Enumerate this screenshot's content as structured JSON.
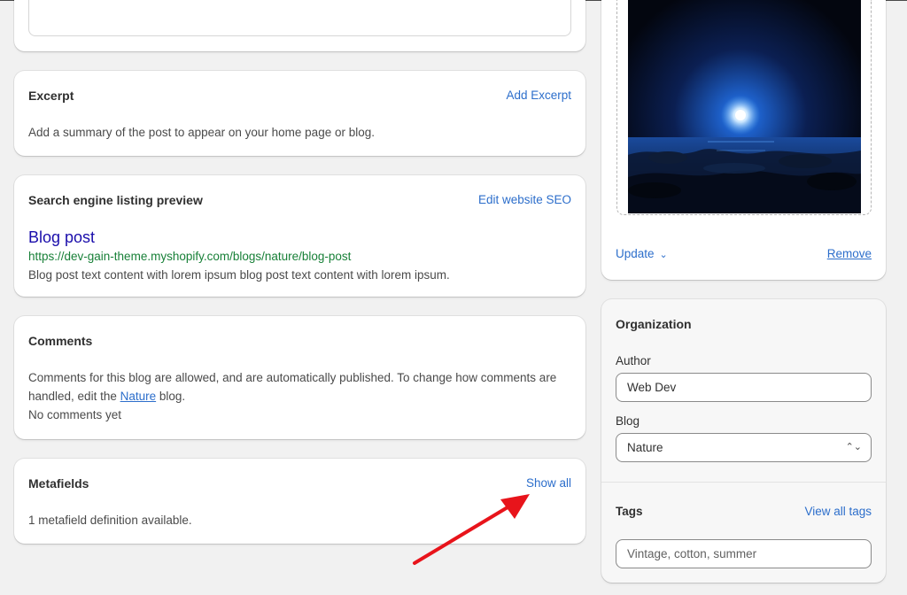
{
  "excerpt": {
    "title": "Excerpt",
    "action": "Add Excerpt",
    "description": "Add a summary of the post to appear on your home page or blog."
  },
  "seo": {
    "title": "Search engine listing preview",
    "action": "Edit website SEO",
    "preview_title": "Blog post",
    "preview_url": "https://dev-gain-theme.myshopify.com/blogs/nature/blog-post",
    "preview_description": "Blog post text content with lorem ipsum blog post text content with lorem ipsum."
  },
  "comments": {
    "title": "Comments",
    "line1": "Comments for this blog are allowed, and are automatically published. To change how comments are",
    "line2_before": "handled, edit the ",
    "line2_link": "Nature",
    "line2_after": " blog.",
    "status": "No comments yet"
  },
  "metafields": {
    "title": "Metafields",
    "action": "Show all",
    "description": "1 metafield definition available."
  },
  "image": {
    "icon": "night-ocean-image",
    "update_label": "Update",
    "remove_label": "Remove"
  },
  "organization": {
    "title": "Organization",
    "author_label": "Author",
    "author_value": "Web Dev",
    "blog_label": "Blog",
    "blog_value": "Nature",
    "tags_label": "Tags",
    "tags_action": "View all tags",
    "tags_placeholder": "Vintage, cotton, summer"
  },
  "colors": {
    "link": "#2c6ecb",
    "seo_title": "#1a0dab",
    "seo_url": "#188038",
    "annotation_arrow": "#e8141b"
  }
}
